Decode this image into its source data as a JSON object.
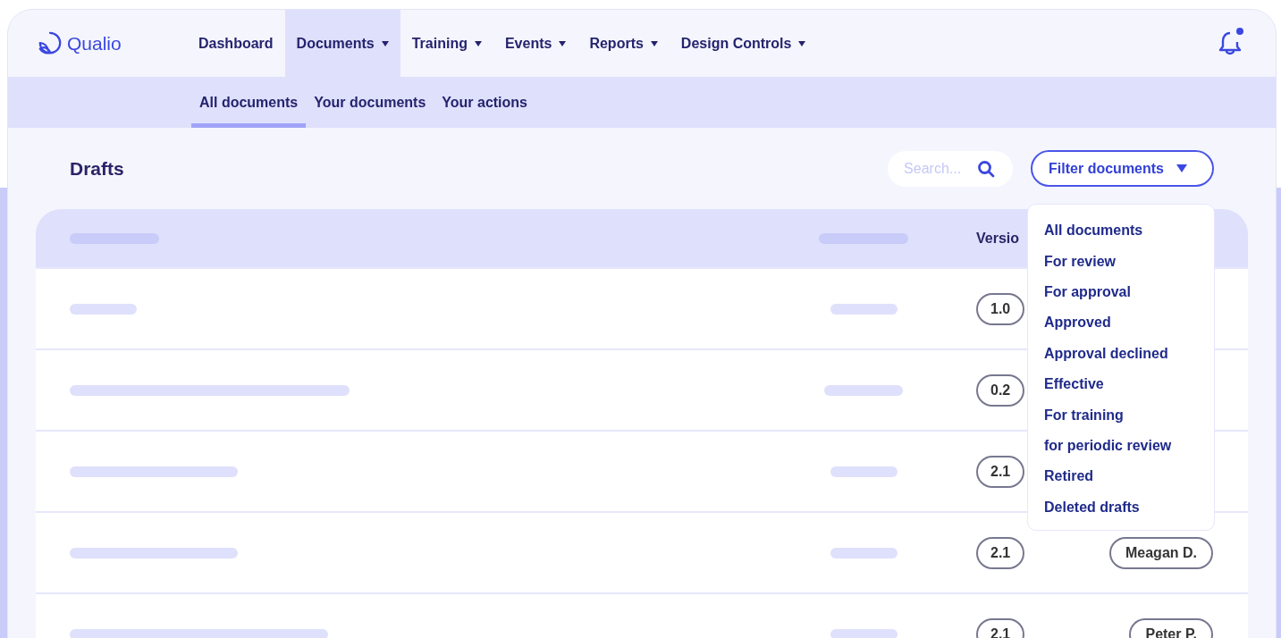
{
  "brand": {
    "name": "Qualio"
  },
  "nav": [
    {
      "label": "Dashboard",
      "selected": false,
      "dropdown": false
    },
    {
      "label": "Documents",
      "selected": true,
      "dropdown": true
    },
    {
      "label": "Training",
      "selected": false,
      "dropdown": true
    },
    {
      "label": "Events",
      "selected": false,
      "dropdown": true
    },
    {
      "label": "Reports",
      "selected": false,
      "dropdown": true
    },
    {
      "label": "Design Controls",
      "selected": false,
      "dropdown": true
    }
  ],
  "notifications": {
    "unread": true
  },
  "subnav": [
    {
      "label": "All documents",
      "selected": true
    },
    {
      "label": "Your documents",
      "selected": false
    },
    {
      "label": "Your actions",
      "selected": false
    }
  ],
  "page_title": "Drafts",
  "search": {
    "placeholder": "Search..."
  },
  "filter_button": {
    "label": "Filter documents"
  },
  "filter_menu": {
    "items": [
      "All documents",
      "For review",
      "For approval",
      "Approved",
      "Approval declined",
      "Effective",
      "For training",
      "for periodic review",
      "Retired",
      "Deleted drafts"
    ]
  },
  "table": {
    "version_header": "Versio",
    "rows": [
      {
        "version": "1.0"
      },
      {
        "version": "0.2"
      },
      {
        "version": "2.1"
      },
      {
        "version": "2.1",
        "owner": "Meagan D."
      },
      {
        "version": "2.1",
        "owner": "Peter P."
      }
    ]
  }
}
